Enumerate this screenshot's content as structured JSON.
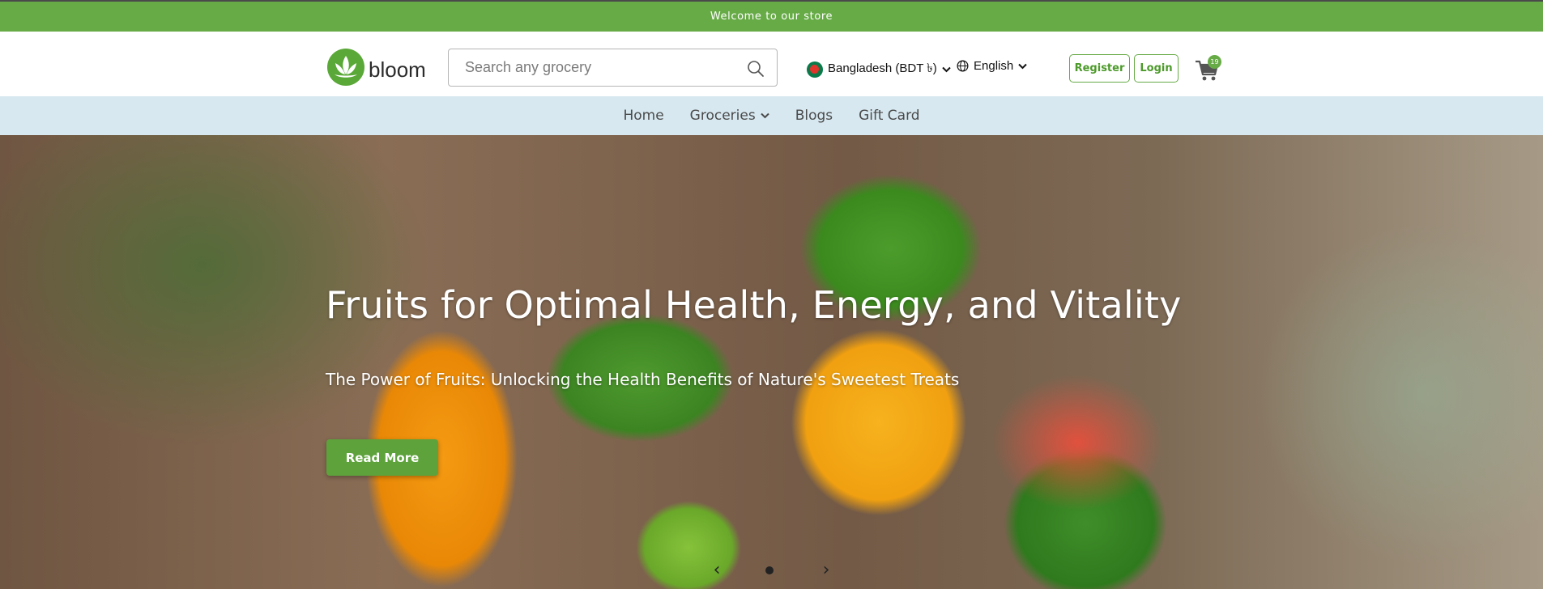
{
  "announcement": {
    "text": "Welcome to our store"
  },
  "header": {
    "logo_text": "bloom",
    "search": {
      "placeholder": "Search any grocery",
      "value": ""
    },
    "country": "Bangladesh (BDT ৳)",
    "language": "English",
    "register_label": "Register",
    "login_label": "Login",
    "cart_count": "19"
  },
  "nav": {
    "items": [
      {
        "label": "Home"
      },
      {
        "label": "Groceries"
      },
      {
        "label": "Blogs"
      },
      {
        "label": "Gift Card"
      }
    ]
  },
  "hero": {
    "title": "Fruits for Optimal Health, Energy, and Vitality",
    "subtitle": "The Power of Fruits: Unlocking the Health Benefits of Nature's Sweetest Treats",
    "cta_label": "Read More",
    "prev_glyph": "‹",
    "next_glyph": "›"
  },
  "colors": {
    "brand_green": "#67ab47",
    "nav_bg": "#d7e8f0"
  },
  "icons": [
    "lotus-logo-icon",
    "search-icon",
    "flag-icon",
    "globe-icon",
    "chevron-down-icon",
    "cart-icon",
    "arrow-left-icon",
    "arrow-right-icon"
  ]
}
